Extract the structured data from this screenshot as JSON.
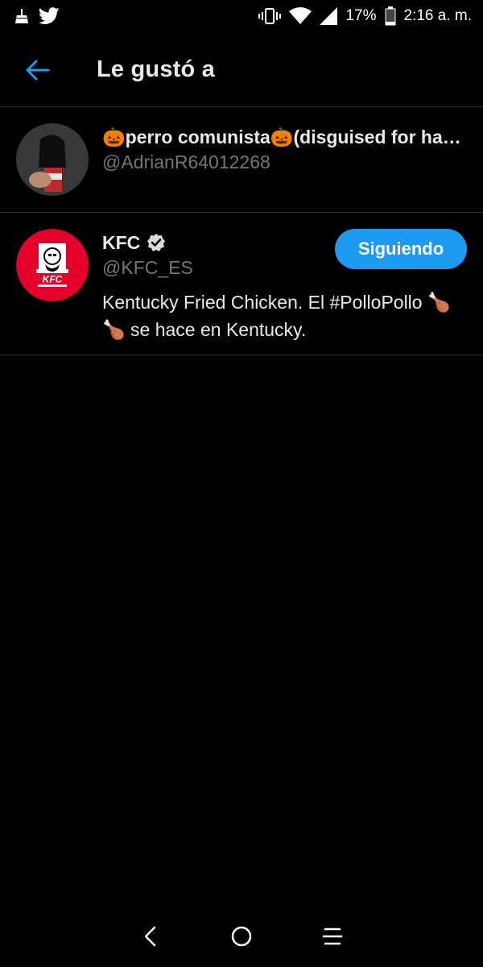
{
  "status_bar": {
    "notification_icons": [
      "broom-icon",
      "twitter-bird-icon"
    ],
    "battery": "17%",
    "time": "2:16 a. m."
  },
  "header": {
    "title": "Le gustó a",
    "back_icon": "arrow-left-icon",
    "accent": "#1d9bf0"
  },
  "users": [
    {
      "name": "🎃perro comunista🎃(disguised for ha…",
      "handle": "@AdrianR64012268"
    },
    {
      "name": "KFC",
      "verified": true,
      "handle": "@KFC_ES",
      "follow_label": "Siguiendo",
      "bio": "Kentucky Fried Chicken. El #PolloPollo 🍗🍗 se hace en Kentucky."
    }
  ],
  "nav_bar": {
    "buttons": [
      "back-triangle-icon",
      "home-circle-icon",
      "recents-menu-icon"
    ]
  }
}
